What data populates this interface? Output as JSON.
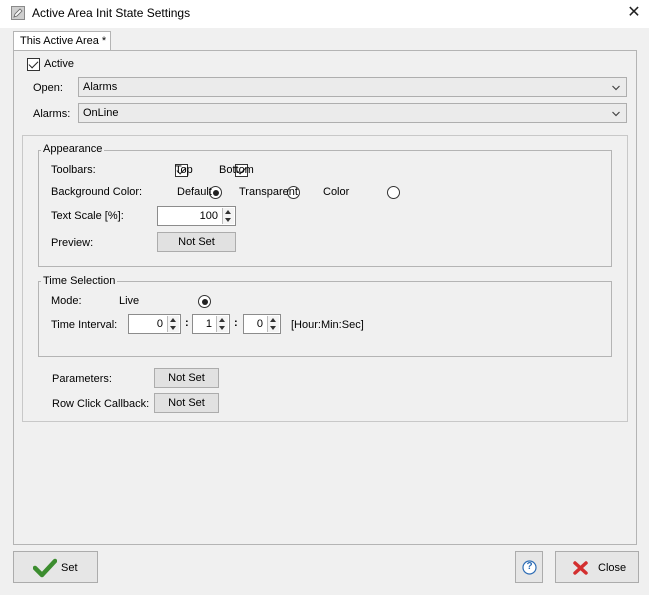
{
  "window": {
    "title": "Active Area Init State Settings"
  },
  "tab": {
    "label": "This Active Area *"
  },
  "active": {
    "label": "Active",
    "checked": true
  },
  "open": {
    "label": "Open:",
    "value": "Alarms"
  },
  "alarms": {
    "label": "Alarms:",
    "value": "OnLine"
  },
  "appearance": {
    "legend": "Appearance",
    "toolbars_label": "Toolbars:",
    "top_label": "Top",
    "bottom_label": "Bottom",
    "bg_label": "Background Color:",
    "bg_default": "Default",
    "bg_transparent": "Transparent",
    "bg_color": "Color",
    "bg_selected": "Default",
    "text_scale_label": "Text Scale [%]:",
    "text_scale_value": "100",
    "preview_label": "Preview:",
    "preview_button": "Not Set"
  },
  "time_selection": {
    "legend": "Time Selection",
    "mode_label": "Mode:",
    "mode_live": "Live",
    "interval_label": "Time Interval:",
    "hours": "0",
    "minutes": "1",
    "seconds": "0",
    "sep": ":",
    "unit_label": "[Hour:Min:Sec]"
  },
  "parameters": {
    "label": "Parameters:",
    "button": "Not Set"
  },
  "row_click": {
    "label": "Row Click Callback:",
    "button": "Not Set"
  },
  "footer": {
    "set_label": "Set",
    "help_label": "?",
    "close_label": "Close"
  },
  "colors": {
    "accent_check": "#3c8d2f",
    "close_red": "#d32f2f",
    "help_blue": "#2e6db5"
  }
}
